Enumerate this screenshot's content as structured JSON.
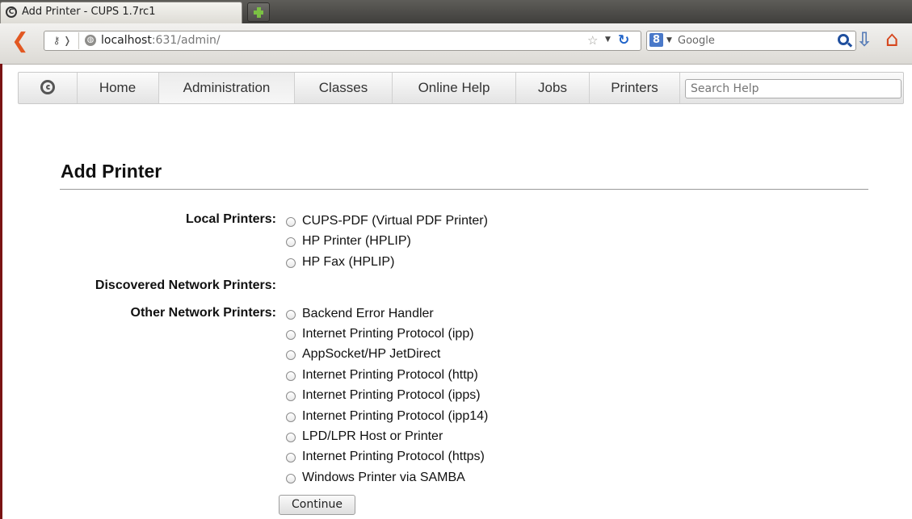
{
  "browser": {
    "tab_title": "Add Printer - CUPS 1.7rc1",
    "url_host": "localhost",
    "url_rest": ":631/admin/",
    "search_engine_placeholder": "Google",
    "engine_glyph": "8"
  },
  "cups_nav": {
    "items": [
      {
        "label": "Home"
      },
      {
        "label": "Administration",
        "active": true
      },
      {
        "label": "Classes"
      },
      {
        "label": "Online Help"
      },
      {
        "label": "Jobs"
      },
      {
        "label": "Printers"
      }
    ],
    "search_placeholder": "Search Help"
  },
  "page": {
    "title": "Add Printer",
    "groups": {
      "local": {
        "label": "Local Printers:",
        "options": [
          "CUPS-PDF (Virtual PDF Printer)",
          "HP Printer (HPLIP)",
          "HP Fax (HPLIP)"
        ]
      },
      "discovered": {
        "label": "Discovered Network Printers:"
      },
      "other": {
        "label": "Other Network Printers:",
        "options": [
          "Backend Error Handler",
          "Internet Printing Protocol (ipp)",
          "AppSocket/HP JetDirect",
          "Internet Printing Protocol (http)",
          "Internet Printing Protocol (ipps)",
          "Internet Printing Protocol (ipp14)",
          "LPD/LPR Host or Printer",
          "Internet Printing Protocol (https)",
          "Windows Printer via SAMBA"
        ]
      }
    },
    "continue_label": "Continue"
  },
  "colors": {
    "sidebar_edge": "#7a1313",
    "back_arrow": "#e25822",
    "reload": "#1f63c9"
  }
}
